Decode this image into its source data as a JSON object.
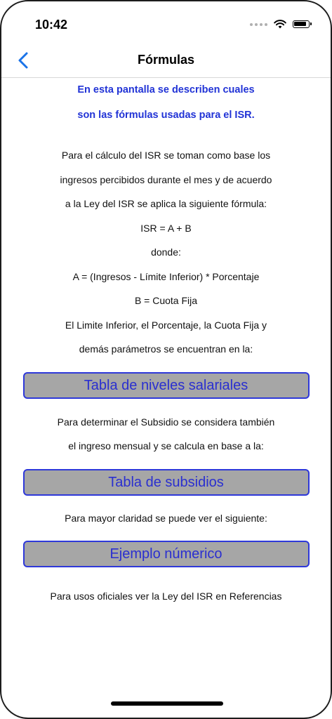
{
  "status_bar": {
    "time": "10:42",
    "icons": [
      "signal-icon",
      "wifi-icon",
      "battery-icon"
    ]
  },
  "nav": {
    "back_icon": "chevron-left-icon",
    "title": "Fórmulas"
  },
  "intro": {
    "line1": "En esta pantalla se describen cuales",
    "line2": "son las fórmulas usadas para el ISR."
  },
  "explanation": [
    "Para el cálculo del ISR se toman  como base los",
    "ingresos percibidos durante el mes y de acuerdo",
    "a la Ley del ISR se aplica la siguiente fórmula:",
    "ISR = A + B",
    "donde:",
    "A = (Ingresos - Límite Inferior) * Porcentaje",
    "B = Cuota Fija",
    "El Limite Inferior, el Porcentaje, la Cuota Fija y",
    "demás parámetros se encuentran en la:"
  ],
  "buttons": {
    "salary_table": "Tabla de niveles salariales",
    "subsidy_table": "Tabla de subsidios",
    "numeric_example": "Ejemplo númerico"
  },
  "subsidy_text": [
    "Para determinar el Subsidio se considera también",
    "el ingreso mensual y  se calcula en base a la:"
  ],
  "example_text": "Para mayor claridad se puede ver el siguiente:",
  "footer_text": "Para usos oficiales ver la Ley del ISR en Referencias",
  "colors": {
    "accent": "#2133d6",
    "button_bg": "#a6a6a6",
    "button_border": "#2e38d9"
  }
}
